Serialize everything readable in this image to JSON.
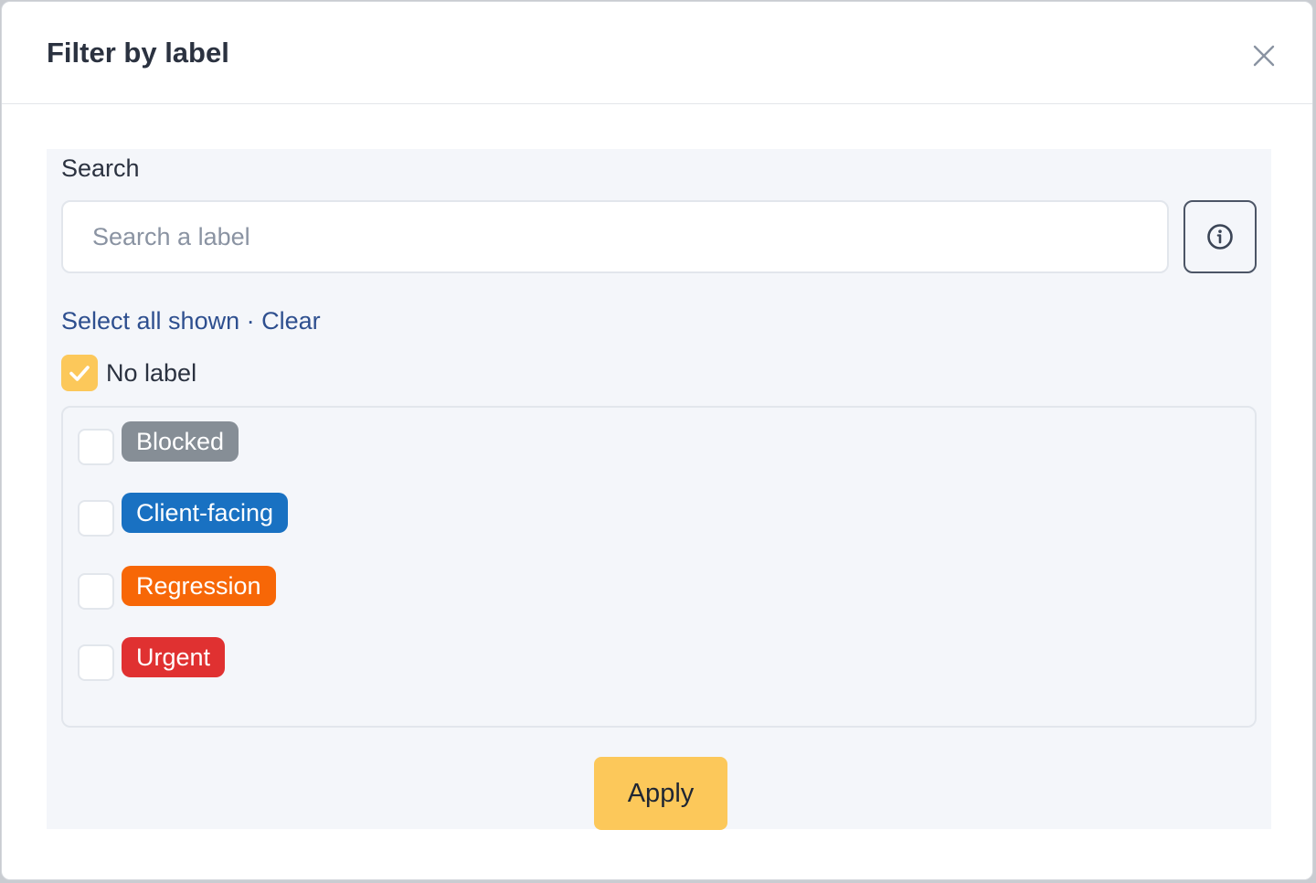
{
  "modal": {
    "title": "Filter by label",
    "close_icon": "close-icon"
  },
  "search": {
    "section_label": "Search",
    "placeholder": "Search a label",
    "value": "",
    "info_icon": "info-icon"
  },
  "bulk_actions": {
    "select_all_label": "Select all shown",
    "separator": "·",
    "clear_label": "Clear"
  },
  "no_label": {
    "label": "No label",
    "checked": true
  },
  "labels": [
    {
      "name": "Blocked",
      "color": "#868e96",
      "checked": false
    },
    {
      "name": "Client-facing",
      "color": "#1971c2",
      "checked": false
    },
    {
      "name": "Regression",
      "color": "#f76707",
      "checked": false
    },
    {
      "name": "Urgent",
      "color": "#e03131",
      "checked": false
    }
  ],
  "footer": {
    "apply_label": "Apply"
  },
  "colors": {
    "accent": "#fcc85a",
    "link": "#2e4f8f",
    "text": "#2b3240"
  }
}
